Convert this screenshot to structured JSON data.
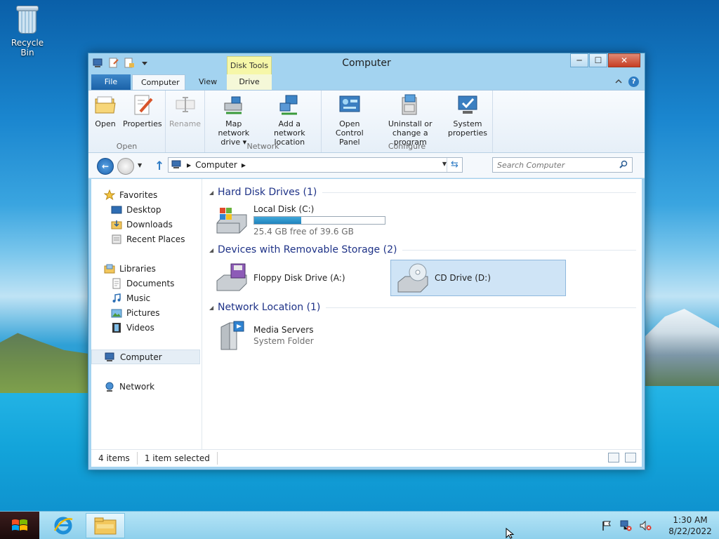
{
  "desktop": {
    "icons": [
      {
        "label": "Recycle Bin",
        "icon": "recycle-bin-icon"
      }
    ]
  },
  "window": {
    "title": "Computer",
    "controls": {
      "minimize": "─",
      "maximize": "☐",
      "close": "✕"
    }
  },
  "ribbon": {
    "context_group": "Disk Tools",
    "tabs": {
      "file": "File",
      "computer": "Computer",
      "view": "View",
      "drive": "Drive"
    },
    "groups": {
      "open": {
        "label": "Open",
        "commands": {
          "open": "Open",
          "properties": "Properties",
          "rename": "Rename"
        }
      },
      "network": {
        "label": "Network",
        "commands": {
          "map_drive_line1": "Map network",
          "map_drive_line2": "drive ▾",
          "add_location_line1": "Add a network",
          "add_location_line2": "location"
        }
      },
      "configure": {
        "label": "Configure",
        "commands": {
          "control_panel_line1": "Open Control",
          "control_panel_line2": "Panel",
          "uninstall_line1": "Uninstall or",
          "uninstall_line2": "change a program",
          "system_line1": "System",
          "system_line2": "properties"
        }
      }
    }
  },
  "address": {
    "path": "Computer",
    "search_placeholder": "Search Computer"
  },
  "nav_pane": {
    "favorites": {
      "label": "Favorites",
      "items": [
        "Desktop",
        "Downloads",
        "Recent Places"
      ]
    },
    "libraries": {
      "label": "Libraries",
      "items": [
        "Documents",
        "Music",
        "Pictures",
        "Videos"
      ]
    },
    "computer": "Computer",
    "network": "Network"
  },
  "content": {
    "groups": {
      "hdd": {
        "title": "Hard Disk Drives (1)"
      },
      "removable": {
        "title": "Devices with Removable Storage (2)"
      },
      "network": {
        "title": "Network Location (1)"
      }
    },
    "items": {
      "local_disk": {
        "name": "Local Disk (C:)",
        "free_text": "25.4 GB free of 39.6 GB",
        "used_fraction": 0.359
      },
      "floppy": {
        "name": "Floppy Disk Drive (A:)"
      },
      "cd": {
        "name": "CD Drive (D:)"
      },
      "media_servers": {
        "name": "Media Servers",
        "type": "System Folder"
      }
    }
  },
  "status": {
    "count": "4 items",
    "selection": "1 item selected"
  },
  "taskbar": {
    "time": "1:30 AM",
    "date": "8/22/2022"
  }
}
